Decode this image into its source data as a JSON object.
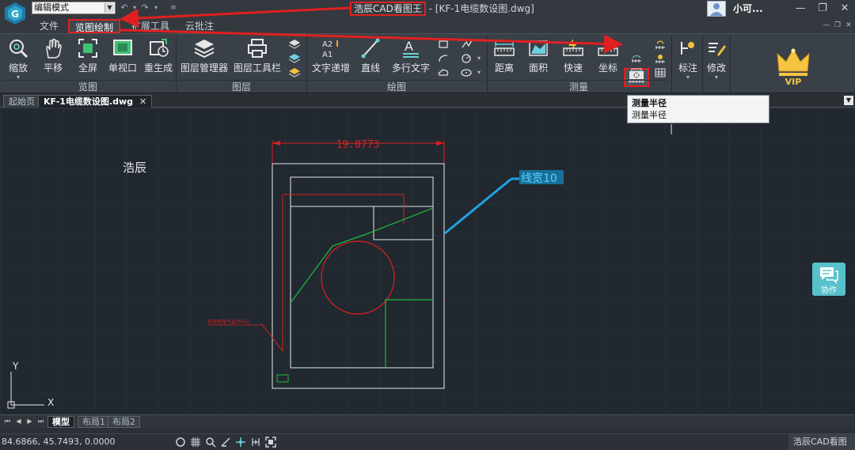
{
  "titlebar": {
    "mode": "编辑模式",
    "app_name": "浩辰CAD看图王",
    "file_suffix": " - [KF-1电缆数设图.dwg]",
    "user_name": "小可...",
    "window_buttons": [
      "minimize-icon",
      "restore-icon",
      "close-icon"
    ]
  },
  "menu": {
    "tabs": [
      "文件",
      "览图绘制",
      "扩展工具",
      "云批注"
    ],
    "active": "览图绘制"
  },
  "ribbon": {
    "groups": [
      "览图",
      "图层",
      "绘图",
      "测量"
    ],
    "view_buttons": [
      "缩放",
      "平移",
      "全屏",
      "单视口",
      "重生成"
    ],
    "layer_buttons": [
      "图层管理器",
      "图层工具栏"
    ],
    "draw_buttons": [
      "文字递增",
      "直线",
      "多行文字"
    ],
    "measure_buttons": [
      "距离",
      "面积",
      "快速",
      "坐标"
    ],
    "right_buttons": [
      "标注",
      "修改"
    ],
    "vip": "VIP"
  },
  "tooltip": {
    "title": "测量半径",
    "desc": "测量半径"
  },
  "doctabs": {
    "tabs": [
      "起始页",
      "KF-1电缆数设图.dwg"
    ]
  },
  "drawing": {
    "dimension": "19.0773",
    "label": "浩辰",
    "line_width": "线宽10",
    "small_text": "孙亚辉电气设计中心"
  },
  "axes": {
    "y": "Y",
    "x": "X"
  },
  "collab": {
    "label": "协作"
  },
  "layout_tabs": [
    "模型",
    "布局1",
    "布局2"
  ],
  "status": {
    "coords": "84.6866, 45.7493, 0.0000",
    "app": "浩辰CAD看图王"
  }
}
